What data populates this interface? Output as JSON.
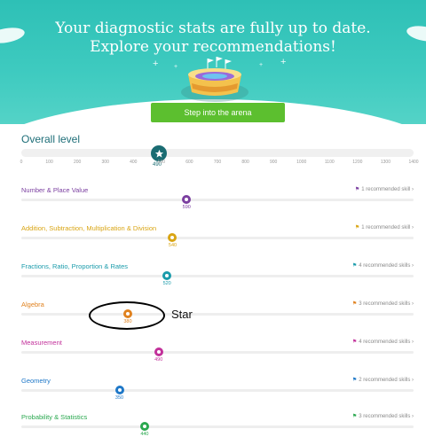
{
  "banner": {
    "headline_line1": "Your diagnostic stats are fully up to date.",
    "headline_line2": "Explore your recommendations!",
    "cta_label": "Step into the arena",
    "bg_color": "#3fcbc0",
    "cta_color": "#5cbf2f"
  },
  "overall": {
    "title": "Overall level",
    "score": "490",
    "icon": "star-icon",
    "ticks": [
      "0",
      "100",
      "200",
      "300",
      "400",
      "500",
      "600",
      "700",
      "800",
      "900",
      "1000",
      "1100",
      "1200",
      "1300",
      "1400"
    ]
  },
  "domains": [
    {
      "name": "Number & Place Value",
      "score": "590",
      "link": "1 recommended skill",
      "color": "#7b3fa0"
    },
    {
      "name": "Addition, Subtraction, Multiplication & Division",
      "score": "540",
      "link": "1 recommended skill",
      "color": "#d9a514"
    },
    {
      "name": "Fractions, Ratio, Proportion & Rates",
      "score": "520",
      "link": "4 recommended skills",
      "color": "#1a9bab"
    },
    {
      "name": "Algebra",
      "score": "380",
      "link": "3 recommended skills",
      "color": "#e0821f"
    },
    {
      "name": "Measurement",
      "score": "490",
      "link": "4 recommended skills",
      "color": "#c2309a"
    },
    {
      "name": "Geometry",
      "score": "350",
      "link": "2 recommended skills",
      "color": "#1f78c8"
    },
    {
      "name": "Probability & Statistics",
      "score": "440",
      "link": "3 recommended skills",
      "color": "#2aa84f"
    }
  ],
  "annotation": {
    "label": "Star"
  }
}
